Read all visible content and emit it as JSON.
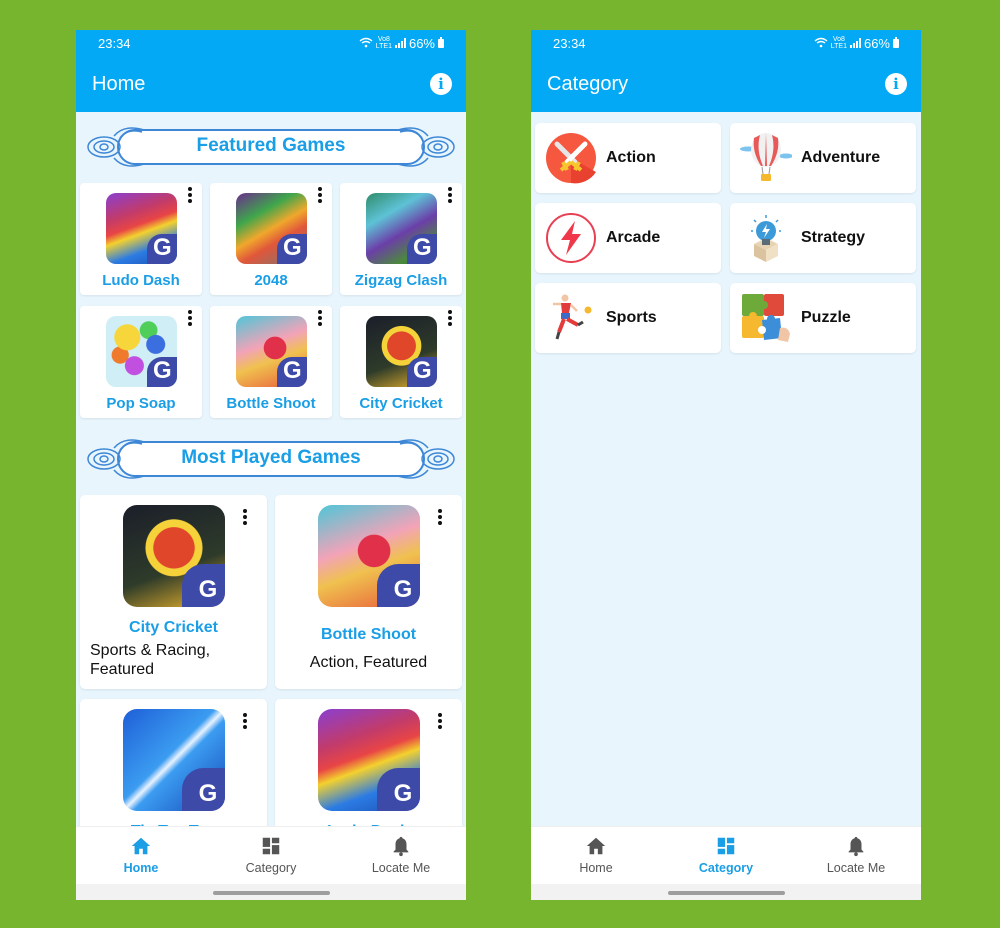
{
  "status_bar": {
    "time": "23:34",
    "carrier": "VoB LTE1",
    "battery": "66%"
  },
  "home": {
    "title": "Home",
    "featured_heading": "Featured Games",
    "featured": [
      {
        "name": "Ludo Dash",
        "thumb": "ludo"
      },
      {
        "name": "2048",
        "thumb": "2048"
      },
      {
        "name": "Zigzag Clash",
        "thumb": "zigzag"
      },
      {
        "name": "Pop Soap",
        "thumb": "popsoap"
      },
      {
        "name": "Bottle Shoot",
        "thumb": "bottle"
      },
      {
        "name": "City Cricket",
        "thumb": "cricket"
      }
    ],
    "most_played_heading": "Most Played Games",
    "most_played": [
      {
        "name": "City Cricket",
        "categories": "Sports & Racing, Featured"
      },
      {
        "name": "Bottle Shoot",
        "categories": "Action, Featured"
      },
      {
        "name": "Tic Tac Toe",
        "categories": ""
      },
      {
        "name": "Ludo Dash",
        "categories": ""
      }
    ]
  },
  "category": {
    "title": "Category",
    "items": [
      {
        "label": "Action",
        "icon": "crossed-swords-icon"
      },
      {
        "label": "Adventure",
        "icon": "hot-air-balloon-icon"
      },
      {
        "label": "Arcade",
        "icon": "lightning-bolt-icon"
      },
      {
        "label": "Strategy",
        "icon": "lightbulb-box-icon"
      },
      {
        "label": "Sports",
        "icon": "soccer-player-icon"
      },
      {
        "label": "Puzzle",
        "icon": "puzzle-pieces-icon"
      }
    ]
  },
  "bottom_nav": [
    {
      "label": "Home",
      "icon": "home-icon"
    },
    {
      "label": "Category",
      "icon": "dashboard-icon"
    },
    {
      "label": "Locate Me",
      "icon": "bell-icon"
    }
  ],
  "colors": {
    "primary": "#03a9f4",
    "accent_text": "#1a9ee6",
    "background": "#e8f5fd",
    "page_bg": "#77b52e",
    "badge": "#3e4aa8"
  }
}
